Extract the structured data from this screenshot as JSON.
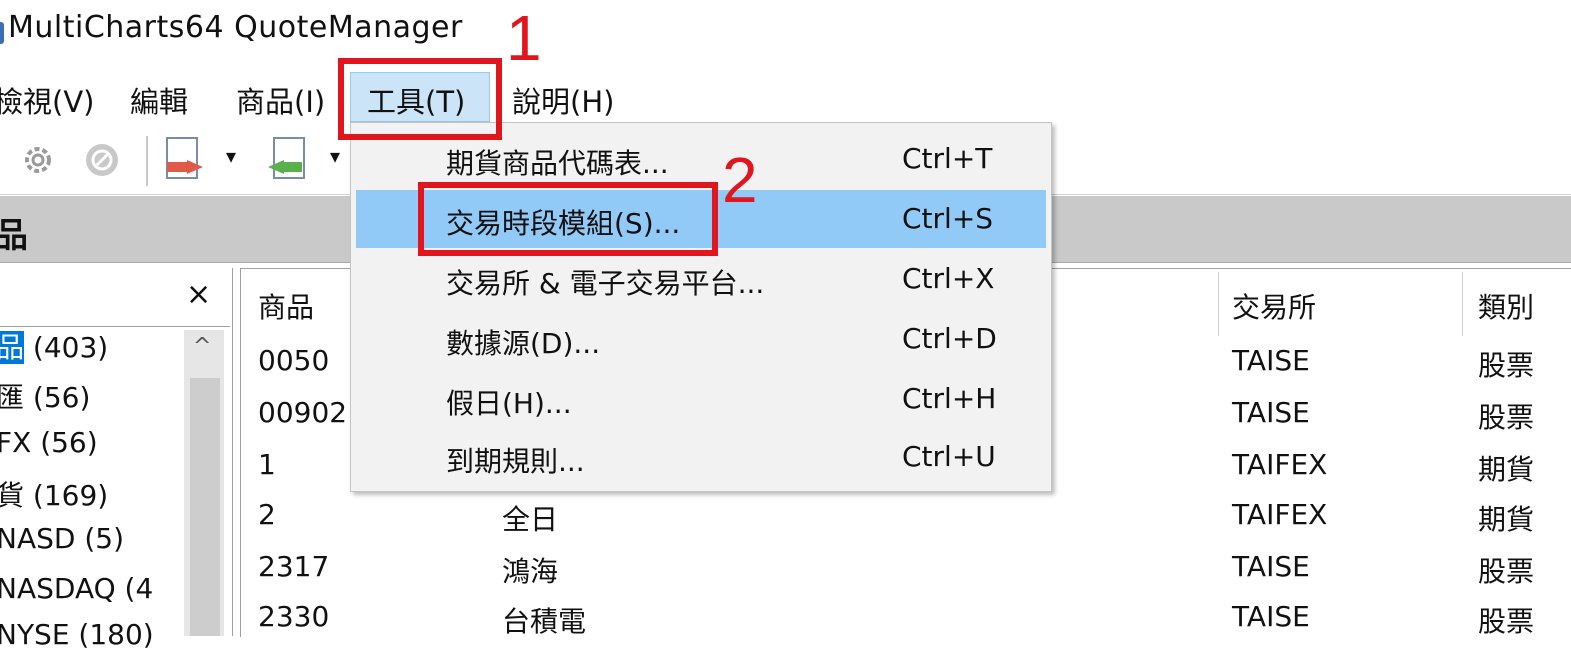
{
  "window": {
    "title": "MultiCharts64 QuoteManager"
  },
  "menubar": {
    "items": [
      {
        "id": "view",
        "label": "檢視(V)"
      },
      {
        "id": "edit",
        "label": "編輯"
      },
      {
        "id": "symbols",
        "label": "商品(I)"
      },
      {
        "id": "tools",
        "label": "工具(T)"
      },
      {
        "id": "help",
        "label": "說明(H)"
      }
    ]
  },
  "tools_menu": {
    "items": [
      {
        "label": "期貨商品代碼表...",
        "shortcut": "Ctrl+T"
      },
      {
        "label": "交易時段模組(S)...",
        "shortcut": "Ctrl+S"
      },
      {
        "label": "交易所 & 電子交易平台...",
        "shortcut": "Ctrl+X"
      },
      {
        "label": "數據源(D)...",
        "shortcut": "Ctrl+D"
      },
      {
        "label": "假日(H)...",
        "shortcut": "Ctrl+H"
      },
      {
        "label": "到期規則...",
        "shortcut": "Ctrl+U"
      }
    ],
    "highlighted_index": 1
  },
  "section": {
    "title": "品"
  },
  "tree": {
    "close_glyph": "×",
    "items": [
      {
        "label": "品",
        "count": " (403)"
      },
      {
        "label": "匯 (56)"
      },
      {
        "label": "FX (56)"
      },
      {
        "label": "貨 (169)"
      },
      {
        "label": "NASD (5)"
      },
      {
        "label": "NASDAQ (4"
      },
      {
        "label": "NYSE (180)"
      }
    ]
  },
  "grid": {
    "columns": {
      "symbol": "商品",
      "exchange": "交易所",
      "category": "類別"
    },
    "rows": [
      {
        "symbol": "0050",
        "name": "",
        "exchange": "TAISE",
        "category": "股票"
      },
      {
        "symbol": "00902",
        "name": "",
        "exchange": "TAISE",
        "category": "股票"
      },
      {
        "symbol": "1",
        "name": "",
        "exchange": "TAIFEX",
        "category": "期貨"
      },
      {
        "symbol": "2",
        "name": "全日",
        "exchange": "TAIFEX",
        "category": "期貨"
      },
      {
        "symbol": "2317",
        "name": "鴻海",
        "exchange": "TAISE",
        "category": "股票"
      },
      {
        "symbol": "2330",
        "name": "台積電",
        "exchange": "TAISE",
        "category": "股票"
      }
    ]
  },
  "annotations": [
    {
      "number": "1",
      "color": "#e0161f"
    },
    {
      "number": "2",
      "color": "#e0161f"
    }
  ],
  "colors": {
    "menu_hover": "#91c9f7",
    "menu_active": "#cce4f7",
    "annotation_red": "#e0161f",
    "header_gray": "#c9c9c9",
    "selection_blue": "#0078d7"
  }
}
